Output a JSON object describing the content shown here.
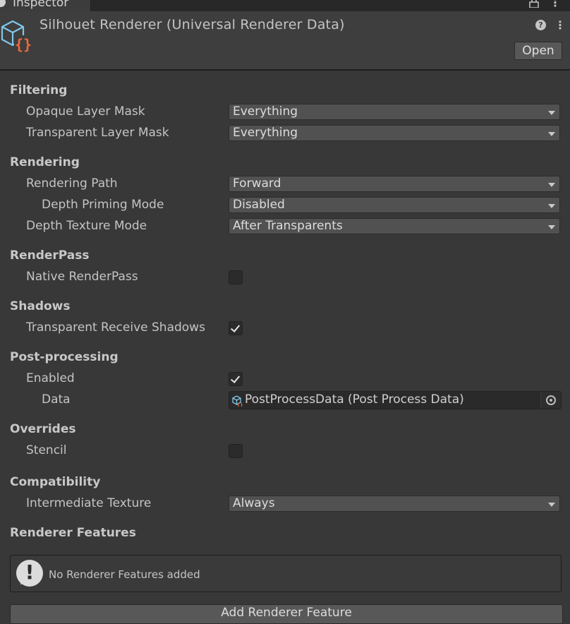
{
  "window": {
    "tab_label": "Inspector",
    "tools": "⋮"
  },
  "header": {
    "title": "Silhouet Renderer (Universal Renderer Data)",
    "help_glyph": "?",
    "more_glyph": "⋮",
    "open_label": "Open"
  },
  "sections": {
    "filtering": "Filtering",
    "rendering": "Rendering",
    "renderpass": "RenderPass",
    "shadows": "Shadows",
    "postprocessing": "Post-processing",
    "overrides": "Overrides",
    "compatibility": "Compatibility",
    "renderer_features": "Renderer Features"
  },
  "fields": {
    "opaque_layer_mask": {
      "label": "Opaque Layer Mask",
      "value": "Everything"
    },
    "transparent_layer_mask": {
      "label": "Transparent Layer Mask",
      "value": "Everything"
    },
    "rendering_path": {
      "label": "Rendering Path",
      "value": "Forward"
    },
    "depth_priming_mode": {
      "label": "Depth Priming Mode",
      "value": "Disabled"
    },
    "depth_texture_mode": {
      "label": "Depth Texture Mode",
      "value": "After Transparents"
    },
    "native_renderpass": {
      "label": "Native RenderPass",
      "checked": false
    },
    "transparent_receive_shadows": {
      "label": "Transparent Receive Shadows",
      "checked": true
    },
    "pp_enabled": {
      "label": "Enabled",
      "checked": true
    },
    "pp_data": {
      "label": "Data",
      "value": "PostProcessData (Post Process Data)"
    },
    "stencil": {
      "label": "Stencil",
      "checked": false
    },
    "intermediate_texture": {
      "label": "Intermediate Texture",
      "value": "Always"
    }
  },
  "renderer_features": {
    "empty_message": "No Renderer Features added",
    "add_button": "Add Renderer Feature"
  },
  "colors": {
    "accent_orange": "#f06a3c",
    "accent_blue": "#7fc6e8"
  }
}
